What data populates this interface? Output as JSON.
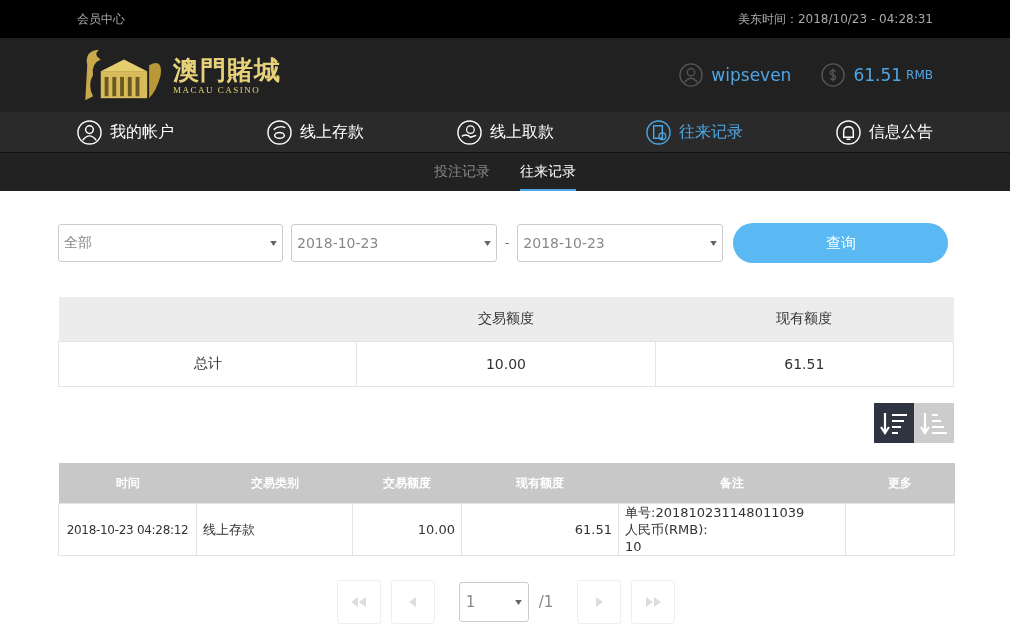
{
  "top_bar": {
    "title": "会员中心",
    "clock": "美东时间：2018/10/23 - 04:28:31"
  },
  "logo": {
    "name": "澳門賭城",
    "subtitle": "MACAU CASINO"
  },
  "account": {
    "username": "wipseven",
    "balance": "61.51",
    "currency": "RMB"
  },
  "nav": [
    {
      "label": "我的帐户",
      "kind": "user",
      "selected": false
    },
    {
      "label": "线上存款",
      "kind": "deposit",
      "selected": false
    },
    {
      "label": "线上取款",
      "kind": "withdraw",
      "selected": false
    },
    {
      "label": "往来记录",
      "kind": "records",
      "selected": true
    },
    {
      "label": "信息公告",
      "kind": "bell",
      "selected": false
    }
  ],
  "subtabs": [
    {
      "label": "投注记录",
      "selected": false
    },
    {
      "label": "往来记录",
      "selected": true
    }
  ],
  "filters": {
    "type": "全部",
    "date_from": "2018-10-23",
    "separator": "-",
    "date_to": "2018-10-23",
    "query_button": "查询"
  },
  "summary": {
    "columns": [
      "",
      "交易额度",
      "现有额度"
    ],
    "rows": [
      [
        "总计",
        "10.00",
        "61.51"
      ]
    ]
  },
  "sort_buttons": [
    {
      "kind": "descending",
      "selected": true
    },
    {
      "kind": "ascending",
      "selected": false
    }
  ],
  "records": {
    "columns": [
      "时间",
      "交易类别",
      "交易额度",
      "现有额度",
      "备注",
      "更多"
    ],
    "rows": [
      {
        "time": "2018-10-23 04:28:12",
        "type": "线上存款",
        "amount": "10.00",
        "balance": "61.51",
        "note": [
          "单号:201810231148011039",
          "人民币(RMB):",
          "10"
        ],
        "more": ""
      }
    ]
  },
  "pagination": {
    "page": "1",
    "total": "/1",
    "buttons": [
      {
        "kind": "first",
        "disabled": true
      },
      {
        "kind": "prev",
        "disabled": true
      },
      {
        "kind": "next",
        "disabled": true
      },
      {
        "kind": "last",
        "disabled": true
      }
    ]
  }
}
